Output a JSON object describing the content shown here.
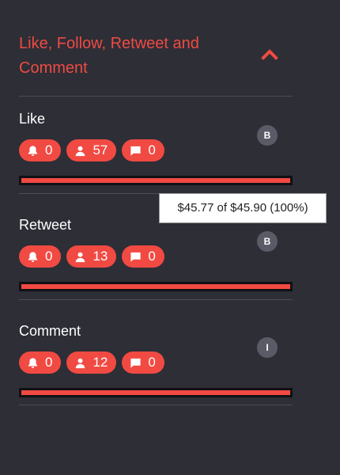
{
  "panel": {
    "title": "Like, Follow, Retweet and Comment",
    "collapse_icon": "chevron-up-icon",
    "accent_color": "#f04a43",
    "sections": [
      {
        "title": "Like",
        "badge": "B",
        "likes": "0",
        "followers": "57",
        "comments": "0",
        "progress": 1.0
      },
      {
        "title": "Retweet",
        "badge": "B",
        "likes": "0",
        "followers": "13",
        "comments": "0",
        "progress": 1.0
      },
      {
        "title": "Comment",
        "badge": "I",
        "likes": "0",
        "followers": "12",
        "comments": "0",
        "progress": 1.0
      }
    ]
  },
  "tooltip": {
    "text": "$45.77 of $45.90 (100%)"
  },
  "icons": {
    "likes": "bell-icon",
    "followers": "user-icon",
    "comments": "comment-icon"
  }
}
